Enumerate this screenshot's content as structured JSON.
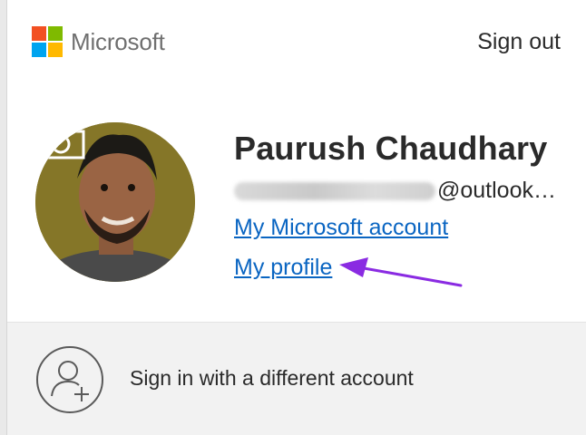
{
  "header": {
    "brand": "Microsoft",
    "sign_out": "Sign out",
    "logo_colors": [
      "#f25022",
      "#7fba00",
      "#00a4ef",
      "#ffb900"
    ]
  },
  "profile": {
    "name": "Paurush Chaudhary",
    "email_domain": "@outlook…",
    "links": {
      "account": "My Microsoft account",
      "profile": "My profile"
    }
  },
  "other_account": {
    "label": "Sign in with a different account"
  },
  "colors": {
    "link": "#0a65c2",
    "annotation_arrow": "#8a2be2"
  },
  "icons": [
    "microsoft-logo-icon",
    "camera-icon",
    "add-person-icon",
    "arrow-annotation-icon"
  ]
}
